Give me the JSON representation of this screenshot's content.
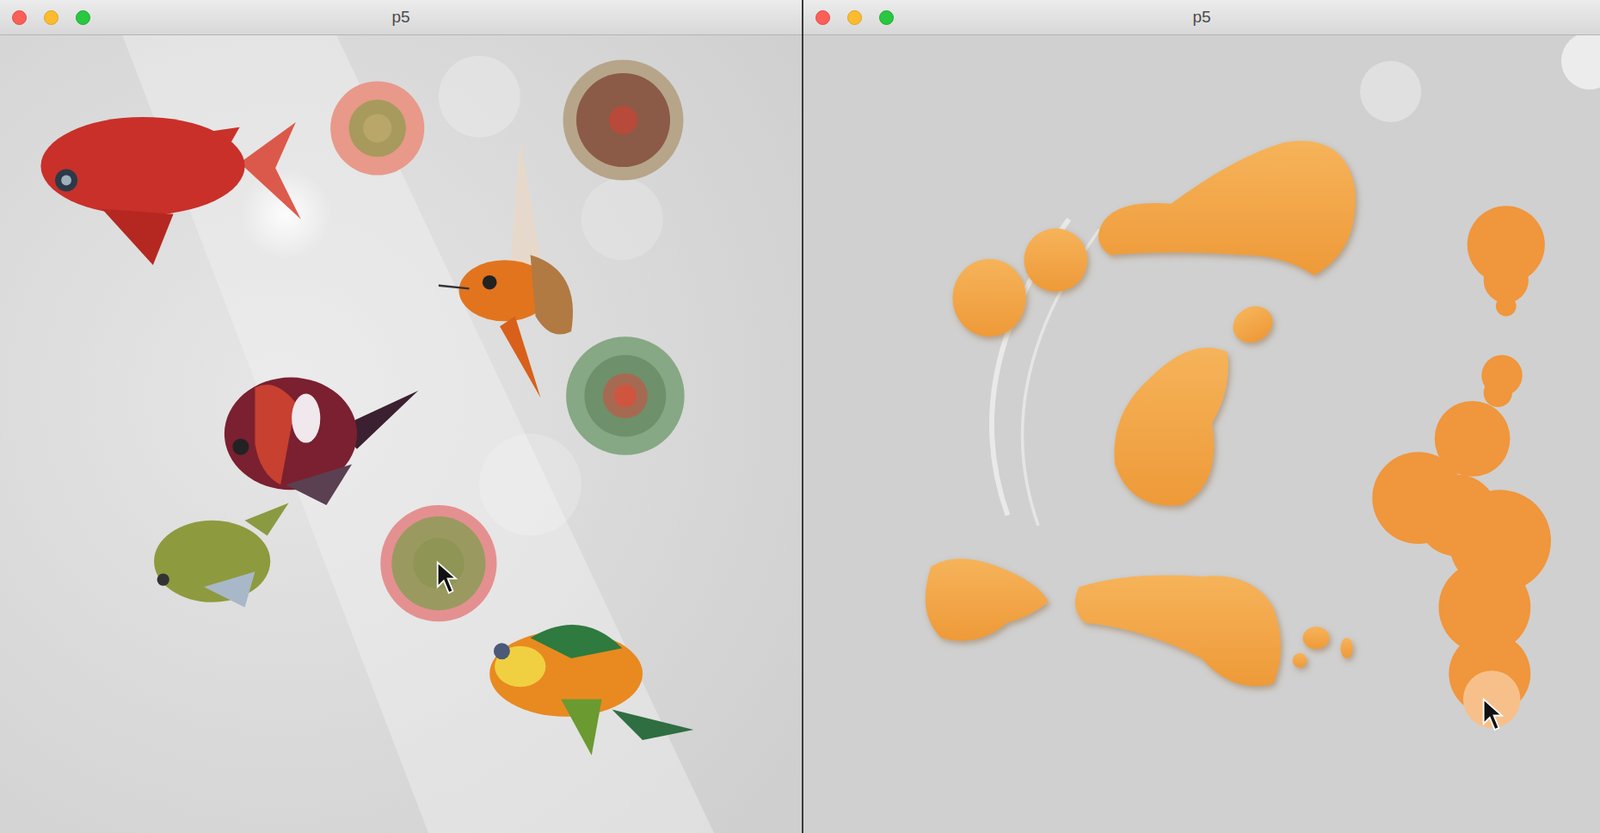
{
  "windows": [
    {
      "title": "p5"
    },
    {
      "title": "p5"
    }
  ]
}
